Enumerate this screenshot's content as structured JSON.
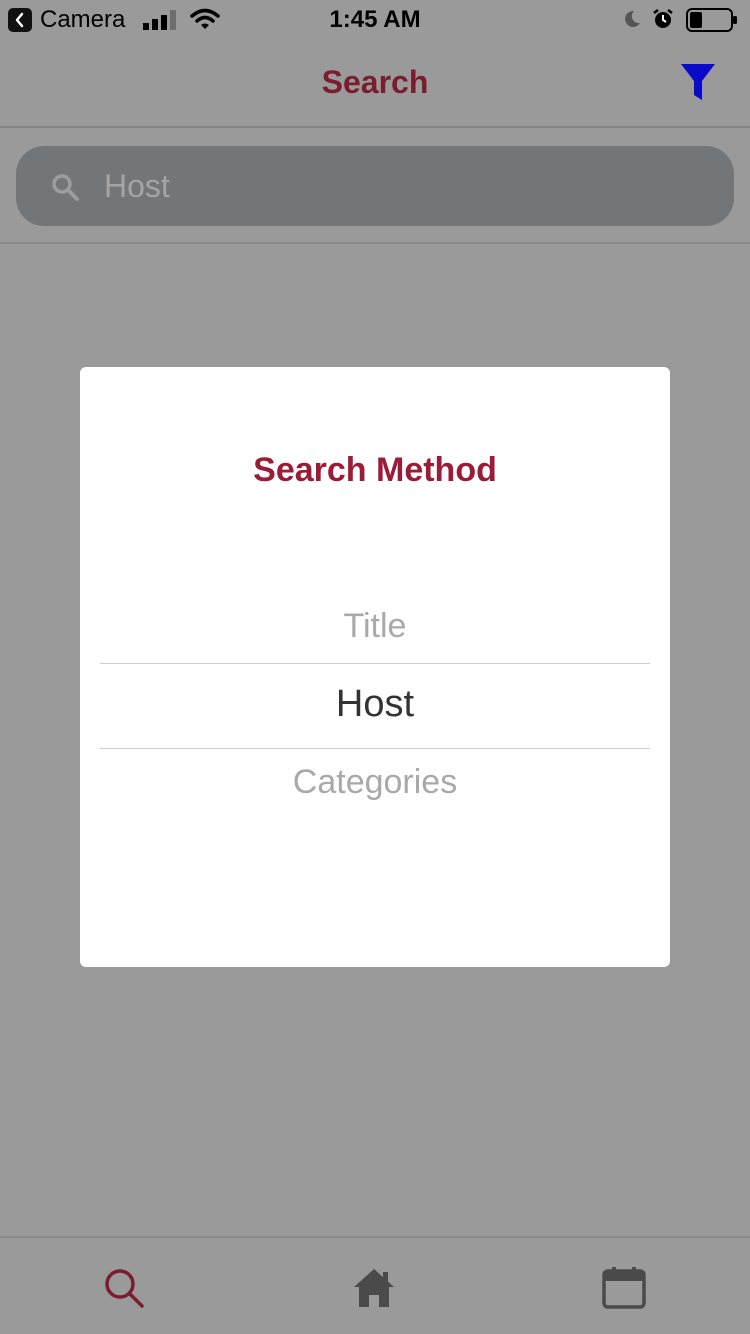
{
  "status_bar": {
    "back_app_label": "Camera",
    "time": "1:45 AM",
    "icons": [
      "back-chevron-icon",
      "signal-icon",
      "wifi-icon",
      "moon-icon",
      "alarm-icon",
      "battery-icon"
    ]
  },
  "nav": {
    "title": "Search",
    "filter_icon": "filter-icon",
    "filter_color": "#0a0ac8",
    "title_color": "#7a1d2e"
  },
  "search": {
    "placeholder": "Host",
    "icon": "search-icon"
  },
  "modal": {
    "title": "Search Method",
    "title_color": "#9c1c38",
    "options": [
      {
        "label": "Title",
        "selected": false
      },
      {
        "label": "Host",
        "selected": true
      },
      {
        "label": "Categories",
        "selected": false
      }
    ]
  },
  "tab_bar": {
    "tabs": [
      {
        "name": "search",
        "icon": "search-icon",
        "active": true
      },
      {
        "name": "home",
        "icon": "home-icon",
        "active": false
      },
      {
        "name": "calendar",
        "icon": "calendar-icon",
        "active": false
      }
    ],
    "active_color": "#7a1d2e",
    "inactive_color": "#4a4a4a"
  }
}
